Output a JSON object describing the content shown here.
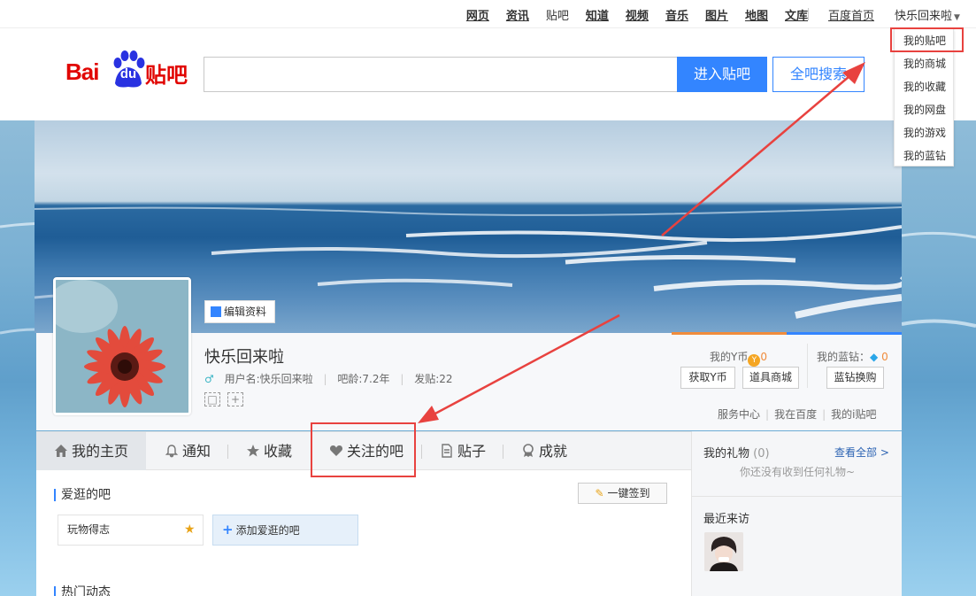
{
  "topnav": {
    "links": [
      "网页",
      "资讯",
      "贴吧",
      "知道",
      "视频",
      "音乐",
      "图片",
      "地图",
      "文库"
    ],
    "home": "百度首页",
    "user": "快乐回来啦"
  },
  "header": {
    "logo_bai": "Bai",
    "logo_du": "du",
    "logo_tieba": "贴吧",
    "search_value": "",
    "enter_button": "进入贴吧",
    "all_search_button": "全吧搜索"
  },
  "dropdown": {
    "items": [
      "我的贴吧",
      "我的商城",
      "我的收藏",
      "我的网盘",
      "我的游戏",
      "我的蓝钻"
    ]
  },
  "profile": {
    "edit_button": "编辑资料",
    "display_name": "快乐回来啦",
    "username": "用户名:快乐回来啦",
    "age": "吧龄:7.2年",
    "posts": "发贴:22",
    "badge_1": "□",
    "badge_2": "+",
    "ycoin_label": "我的Y币",
    "ycoin_icon": "Y",
    "ycoin_value": "0",
    "diamond_label": "我的蓝钻：",
    "diamond_value": "0",
    "get_ycoin": "获取Y币",
    "prop_mall": "道具商城",
    "diamond_exchange": "蓝钻换购",
    "service_center": "服务中心",
    "in_baidu": "我在百度",
    "my_ipost": "我的i贴吧"
  },
  "tabs": [
    {
      "label": "我的主页",
      "icon": "home-icon"
    },
    {
      "label": "通知",
      "icon": "bell-icon"
    },
    {
      "label": "收藏",
      "icon": "star-icon"
    },
    {
      "label": "关注的吧",
      "icon": "heart-icon"
    },
    {
      "label": "贴子",
      "icon": "document-icon"
    },
    {
      "label": "成就",
      "icon": "medal-icon"
    }
  ],
  "main": {
    "fav_title": "爱逛的吧",
    "checkin_button": "一键签到",
    "bar_item": "玩物得志",
    "add_bar": "添加爱逛的吧",
    "hot_title": "热门动态"
  },
  "sidebar": {
    "gift_title": "我的礼物",
    "gift_count": "(0)",
    "view_all": "查看全部 >",
    "gift_empty": "你还没有收到任何礼物~",
    "recent_title": "最近来访"
  },
  "colors": {
    "accent": "#3385ff",
    "brand_red": "#e10602",
    "annotation_red": "#e8423f"
  }
}
